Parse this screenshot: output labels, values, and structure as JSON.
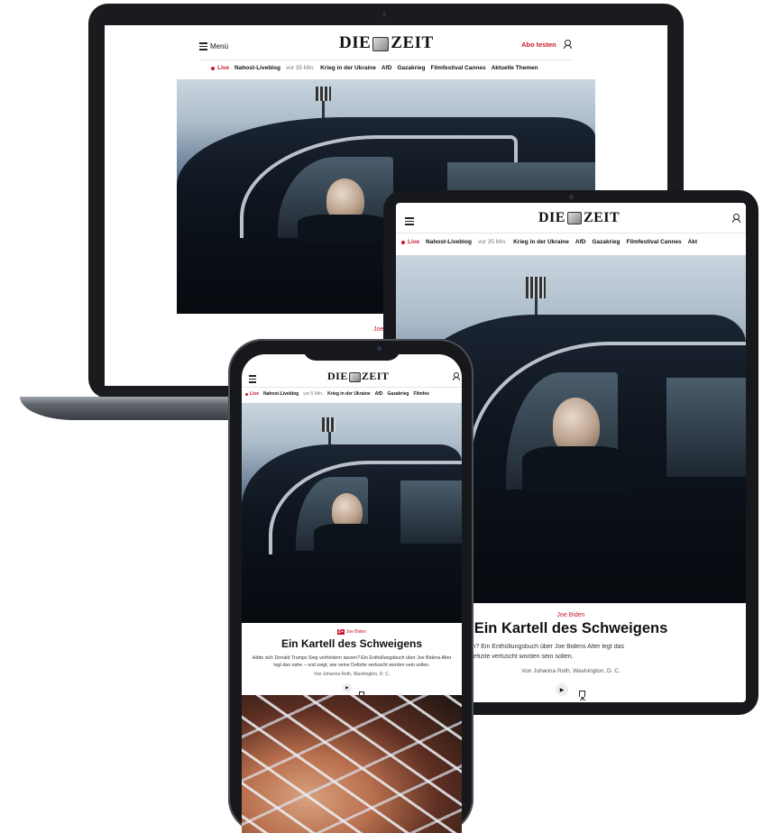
{
  "brand": {
    "logo_text": "DIE ZEIT",
    "logo_left": "DIE",
    "logo_right": "ZEIT",
    "accent_color": "#c9182c"
  },
  "header": {
    "menu_label": "Menü",
    "subscribe_label": "Abo testen"
  },
  "nav": {
    "live_label": "Live",
    "items": [
      "Nahost-Liveblog",
      "Krieg in der Ukraine",
      "AfD",
      "Gazakrieg",
      "Filmfestival Cannes",
      "Aktuelle Themen"
    ],
    "laptop_time": "vor 35 Min.",
    "tablet_time": "vor 35 Min.",
    "phone_time": "vor 5 Min.",
    "tablet_truncated_last": "Akt",
    "phone_truncated_last": "Filmfes"
  },
  "article": {
    "kicker": "Joe Biden",
    "headline": "Ein Kartell des Schweigens",
    "zplus_badge": "Z+",
    "phone_teaser": "Hätte sich Donald Trumps Sieg verhindern lassen? Ein Enthüllungsbuch über Joe Bidens Alter legt das nahe – und zeigt, wie seine Defizite vertuscht worden sein sollen.",
    "tablet_teaser_line1": "mps Sieg verhindern lassen? Ein Enthüllungsbuch über Joe Bidens Alter legt das",
    "tablet_teaser_line2": "he – und zeigt, wie seine Defizite vertuscht worden sein sollen.",
    "byline": "Von Johanna Roth, Washington, D. C.",
    "laptop_kicker_fragment": "Joe"
  },
  "icons": {
    "menu": "menu-icon",
    "account": "user-icon",
    "play": "play-icon",
    "bookmark": "bookmark-icon",
    "play_glyph": "▶"
  }
}
